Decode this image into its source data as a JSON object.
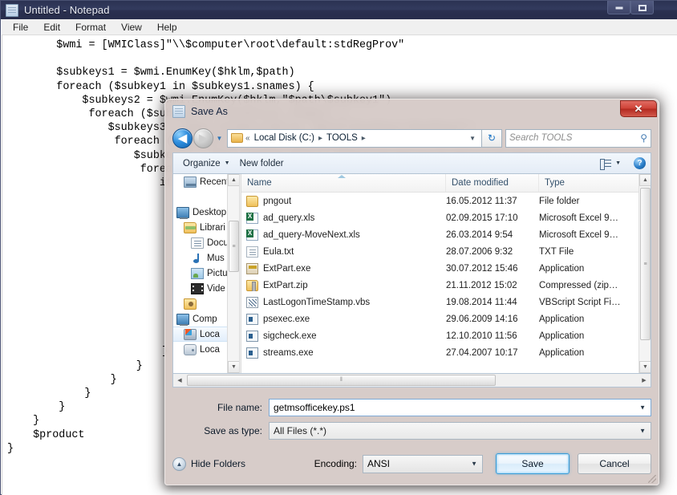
{
  "notepad": {
    "title": "Untitled - Notepad",
    "icon": "notepad-icon",
    "menu": [
      "File",
      "Edit",
      "Format",
      "View",
      "Help"
    ],
    "window_buttons": {
      "minimize": "–",
      "maximize": "❐",
      "close": "✕"
    },
    "code": "        $wmi = [WMIClass]\"\\\\$computer\\root\\default:stdRegProv\"\n\n        $subkeys1 = $wmi.EnumKey($hklm,$path)\n        foreach ($subkey1 in $subkeys1.snames) {\n            $subkeys2 = $wmi.EnumKey($hklm,\"$path\\$subkey1\")\n             foreach ($subkey2 in $subkeys2.snames) {\n                $subkeys3 = $wmi.EnumKey($hklm,\"$path\\$subkey1\\$subkey2\")\n                 foreach ($subkey3 in $subkeys3.snames) {\n                    $subkeys4 = $wmi.EnumKey($hklm,\"$path\\$subkey1\\$subkey2\\$subkey3\")\n                     foreach ($subkey4 in $subkeys4.snames) {\n                        if ($subkey4 -eq \"Registration\") {",
    "code_tail_lines": [
      "                                }",
      "                            }",
      "                        }",
      "                    }",
      "                }",
      "            }",
      "        }",
      "    }",
      "    $product",
      "}"
    ]
  },
  "dialog": {
    "title": "Save As",
    "app_icon": "notepad-icon",
    "close_label": "✕",
    "nav": {
      "back_icon": "◀",
      "forward_icon": "▶",
      "recent_dropdown_icon": "▼",
      "refresh_icon": "↻",
      "breadcrumb_prefix": "«",
      "breadcrumb": [
        "Local Disk (C:)",
        "TOOLS"
      ],
      "breadcrumb_sep": "▸",
      "breadcrumb_dropdown_icon": "▼"
    },
    "search": {
      "placeholder": "Search TOOLS",
      "icon": "search-icon",
      "glyph": "⚲"
    },
    "command_bar": {
      "organize_label": "Organize",
      "organize_caret": "▼",
      "new_folder_label": "New folder",
      "view_caret": "▼",
      "view_icon": "view-layout-icon",
      "help_label": "?"
    },
    "nav_pane": {
      "items": [
        {
          "label": "Recent",
          "icon": "recent-places-icon",
          "indent": 1,
          "selected": false
        },
        {
          "label": "",
          "icon": "spacer",
          "indent": 0,
          "selected": false
        },
        {
          "label": "Desktop",
          "icon": "desktop-icon",
          "indent": 0,
          "selected": false
        },
        {
          "label": "Librari",
          "icon": "libraries-icon",
          "indent": 1,
          "selected": false
        },
        {
          "label": "Docu",
          "icon": "documents-icon",
          "indent": 2,
          "selected": false
        },
        {
          "label": "Mus",
          "icon": "music-icon",
          "indent": 2,
          "selected": false
        },
        {
          "label": "Pictu",
          "icon": "pictures-icon",
          "indent": 2,
          "selected": false
        },
        {
          "label": "Vide",
          "icon": "videos-icon",
          "indent": 2,
          "selected": false
        },
        {
          "label": "",
          "icon": "user-folder-icon",
          "indent": 1,
          "selected": false
        },
        {
          "label": "Comp",
          "icon": "computer-icon",
          "indent": 0,
          "selected": false
        },
        {
          "label": "Loca",
          "icon": "local-disk-c-icon",
          "indent": 1,
          "selected": true
        },
        {
          "label": "Loca",
          "icon": "local-disk-icon",
          "indent": 1,
          "selected": false
        }
      ],
      "scroll_up_icon": "▲",
      "scroll_down_icon": "▼",
      "thumb_grip": "≡"
    },
    "file_list": {
      "columns": [
        "Name",
        "Date modified",
        "Type"
      ],
      "sort_column": "Name",
      "sort_direction": "ascending",
      "rows": [
        {
          "name": "pngout",
          "icon": "folder-icon",
          "date": "16.05.2012 11:37",
          "type": "File folder"
        },
        {
          "name": "ad_query.xls",
          "icon": "excel-file-icon",
          "date": "02.09.2015 17:10",
          "type": "Microsoft Excel 9…"
        },
        {
          "name": "ad_query-MoveNext.xls",
          "icon": "excel-file-icon",
          "date": "26.03.2014 9:54",
          "type": "Microsoft Excel 9…"
        },
        {
          "name": "Eula.txt",
          "icon": "text-file-icon",
          "date": "28.07.2006 9:32",
          "type": "TXT File"
        },
        {
          "name": "ExtPart.exe",
          "icon": "exe-file-icon",
          "date": "30.07.2012 15:46",
          "type": "Application"
        },
        {
          "name": "ExtPart.zip",
          "icon": "zip-file-icon",
          "date": "21.11.2012 15:02",
          "type": "Compressed (zip…"
        },
        {
          "name": "LastLogonTimeStamp.vbs",
          "icon": "vbs-file-icon",
          "date": "19.08.2014 11:44",
          "type": "VBScript Script Fi…"
        },
        {
          "name": "psexec.exe",
          "icon": "app-file-icon",
          "date": "29.06.2009 14:16",
          "type": "Application"
        },
        {
          "name": "sigcheck.exe",
          "icon": "app-file-icon",
          "date": "12.10.2010 11:56",
          "type": "Application"
        },
        {
          "name": "streams.exe",
          "icon": "app-file-icon",
          "date": "27.04.2007 10:17",
          "type": "Application"
        }
      ],
      "vscroll": {
        "up_icon": "▲",
        "down_icon": "▼",
        "thumb_grip": "≡"
      },
      "hscroll": {
        "left_icon": "◀",
        "right_icon": "▶",
        "thumb_grip": "‖"
      }
    },
    "form": {
      "filename_label": "File name:",
      "filename_value": "getmsofficekey.ps1",
      "savetype_label": "Save as type:",
      "savetype_value": "All Files  (*.*)",
      "dropdown_icon": "▼"
    },
    "footer": {
      "hide_folders_label": "Hide Folders",
      "hide_folders_icon": "▲",
      "encoding_label": "Encoding:",
      "encoding_value": "ANSI",
      "encoding_dropdown_icon": "▼",
      "save_label": "Save",
      "cancel_label": "Cancel"
    }
  },
  "colors": {
    "notepad_titlebar": "#2b3252",
    "dialog_chrome": "#d4c8c4",
    "close_button": "#cf4338",
    "save_button_border": "#3c9cd6",
    "selected_row": "#e2eefb"
  }
}
